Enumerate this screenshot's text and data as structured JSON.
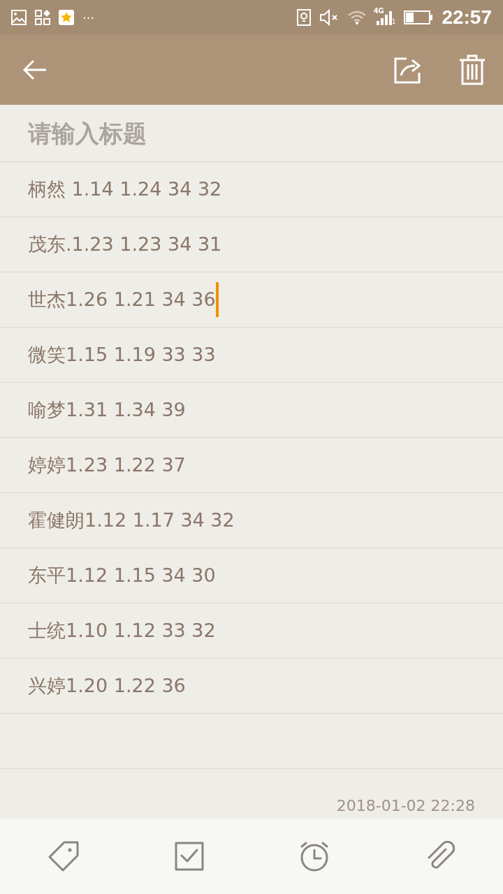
{
  "status_bar": {
    "more": "···",
    "network": "4G",
    "sim": "1",
    "time": "22:57"
  },
  "note": {
    "title_placeholder": "请输入标题",
    "lines": [
      {
        "text": "柄然 1.14 1.24 34 32",
        "cursor": false
      },
      {
        "text": "茂东.1.23 1.23 34 31",
        "cursor": false
      },
      {
        "text": "世杰1.26 1.21 34 36",
        "cursor": true
      },
      {
        "text": "微笑1.15 1.19 33 33",
        "cursor": false
      },
      {
        "text": "喻梦1.31 1.34 39",
        "cursor": false
      },
      {
        "text": "婷婷1.23 1.22 37",
        "cursor": false
      },
      {
        "text": "霍健朗1.12 1.17 34 32",
        "cursor": false
      },
      {
        "text": "东平1.12 1.15 34 30",
        "cursor": false
      },
      {
        "text": "士统1.10 1.12 33 32",
        "cursor": false
      },
      {
        "text": "兴婷1.20 1.22 36",
        "cursor": false
      }
    ],
    "timestamp": "2018-01-02 22:28"
  }
}
